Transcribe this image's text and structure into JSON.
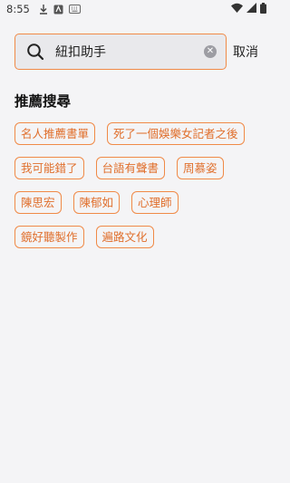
{
  "status_bar": {
    "time": "8:55"
  },
  "search": {
    "query": "紐扣助手",
    "cancel_label": "取消"
  },
  "recommend": {
    "title": "推薦搜尋",
    "rows": [
      [
        "名人推薦書單",
        "死了一個娛樂女記者之後"
      ],
      [
        "我可能錯了",
        "台語有聲書",
        "周慕姿"
      ],
      [
        "陳思宏",
        "陳郁如",
        "心理師"
      ],
      [
        "鏡好聽製作",
        "遍路文化"
      ]
    ]
  },
  "colors": {
    "accent": "#f08a47",
    "tag_text": "#e06f2c",
    "background": "#f4f4f6",
    "search_fill": "#e9e9ec"
  }
}
